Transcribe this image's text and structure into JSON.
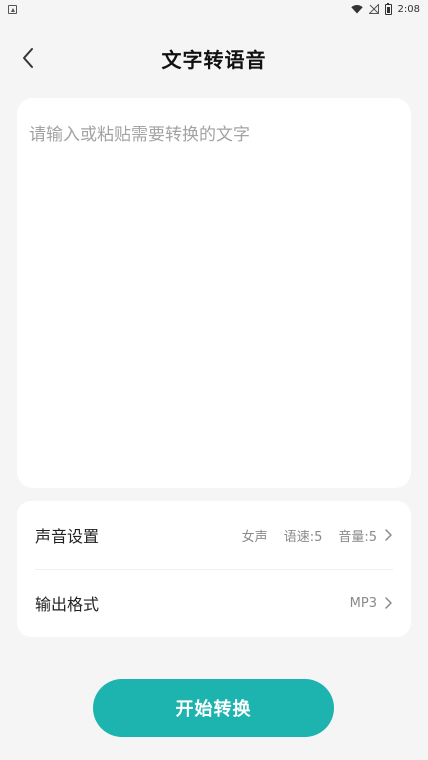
{
  "status_bar": {
    "time": "2:08",
    "icons": [
      "app-notification-icon",
      "wifi-icon",
      "no-signal-icon",
      "battery-icon"
    ]
  },
  "header": {
    "title": "文字转语音",
    "back_icon": "back-chevron-icon"
  },
  "text_input": {
    "placeholder": "请输入或粘贴需要转换的文字",
    "value": ""
  },
  "settings": {
    "voice": {
      "label": "声音设置",
      "gender": "女声",
      "speed": "语速:5",
      "volume": "音量:5"
    },
    "format": {
      "label": "输出格式",
      "value": "MP3"
    }
  },
  "start_button": {
    "label": "开始转换"
  },
  "colors": {
    "accent": "#1db3ae",
    "background": "#f5f5f5",
    "card": "#ffffff",
    "placeholder": "#a3a3a3",
    "secondary_text": "#8a8a8a"
  }
}
